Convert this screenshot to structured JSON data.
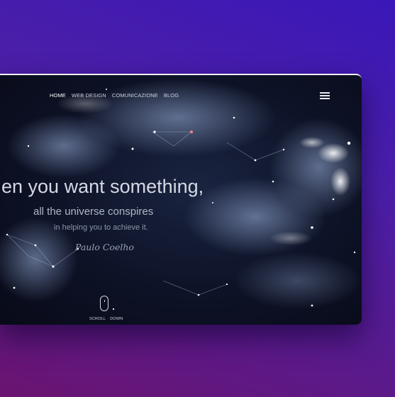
{
  "nav": {
    "items": [
      "HOME",
      "WEB DESIGN",
      "COMUNICAZIONE",
      "BLOG"
    ],
    "active": "HOME",
    "menu_icon": "hamburger-menu-icon"
  },
  "hero": {
    "quote_line1": "en you want something,",
    "quote_line2": "all the universe conspires",
    "quote_line3": "in helping you to achieve it.",
    "author": "Paulo Coelho"
  },
  "scroll": {
    "label_part1": "SCROLL",
    "label_part2": "DOWN",
    "icon": "mouse-scroll-icon"
  },
  "colors": {
    "background_gradient_top": "#3a17b8",
    "background_gradient_bottom": "#6a1470",
    "hero_background": "#0d1226",
    "text_primary": "#d4d9e4"
  }
}
